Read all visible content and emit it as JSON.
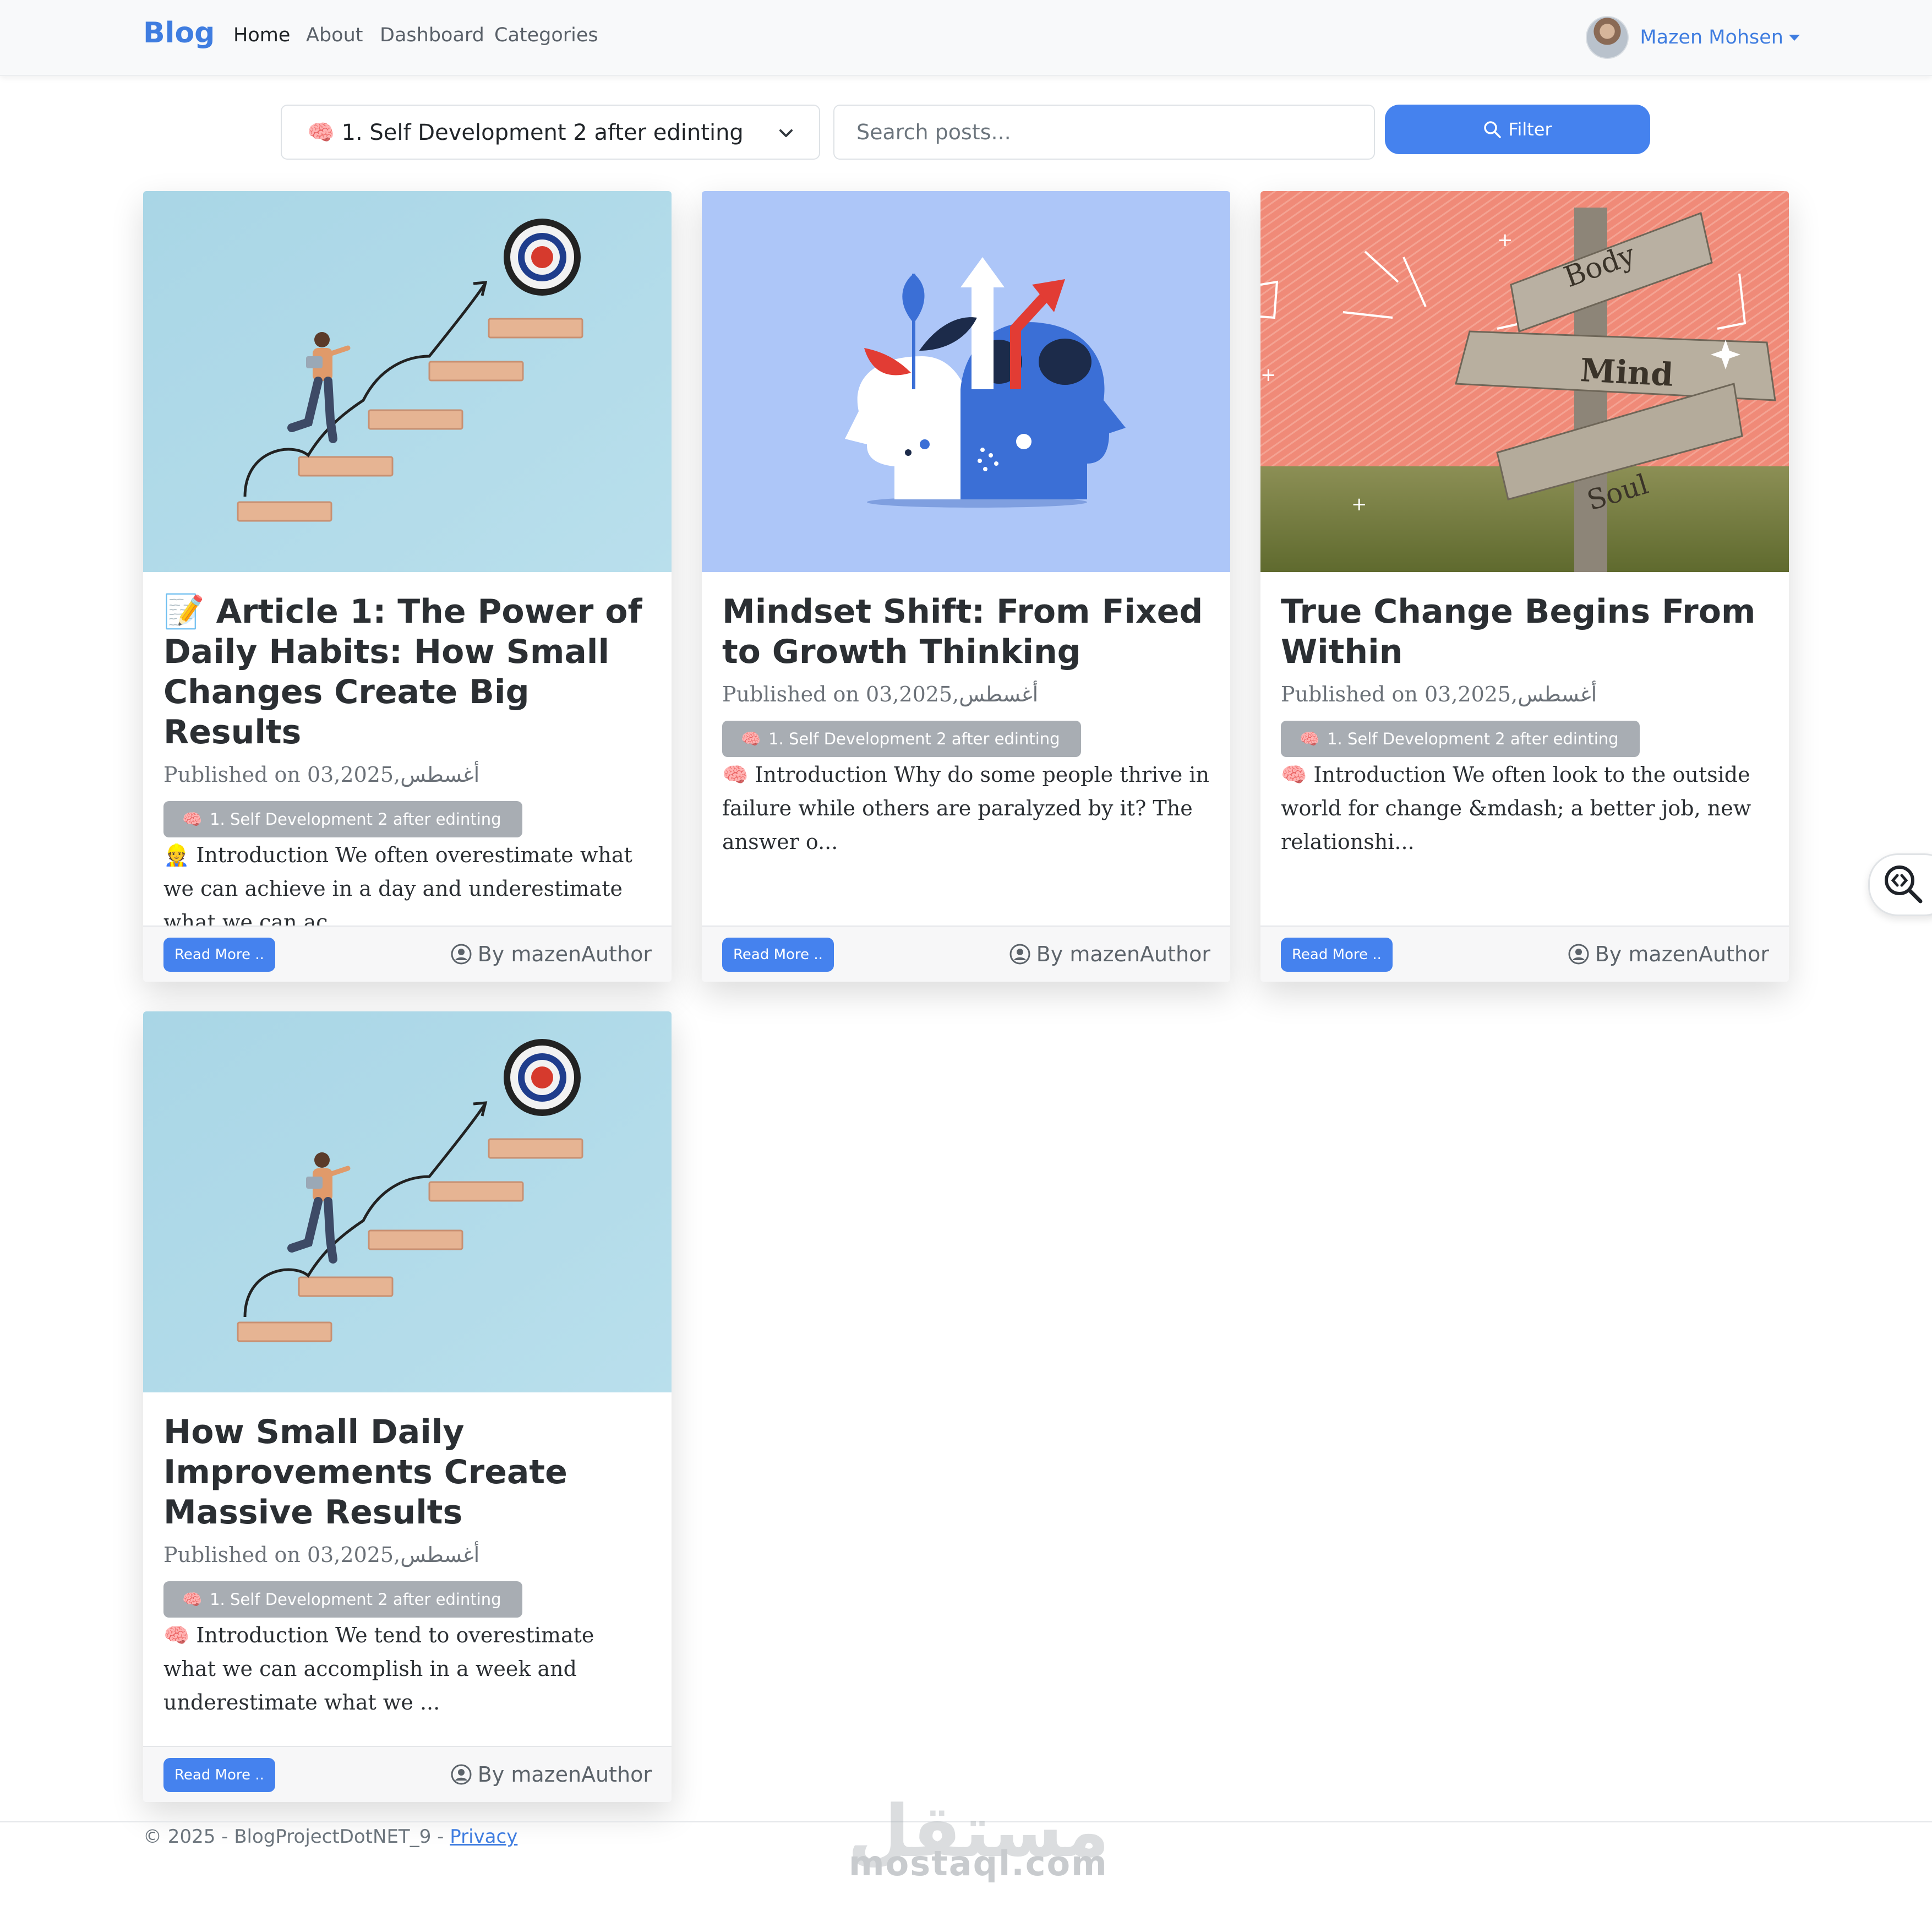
{
  "navbar": {
    "brand": "Blog",
    "links": [
      "Home",
      "About",
      "Dashboard",
      "Categories"
    ],
    "user_name": "Mazen Mohsen"
  },
  "filter": {
    "selected_category": "🧠 1. Self Development 2 after edinting",
    "search_placeholder": "Search posts...",
    "search_value": "",
    "filter_label": "Filter"
  },
  "posts": [
    {
      "title": "📝 Article 1: The Power of Daily Habits: How Small Changes Create Big Results",
      "date": "Published on 03,2025,أغسطس",
      "category": "1. Self Development 2 after edinting",
      "category_emoji": "🧠",
      "excerpt": "👷 Introduction We often overestimate what we can achieve in a day and underestimate what we can ac...",
      "read_more": "Read More ..",
      "author": "By mazenAuthor",
      "image": "stairs-target"
    },
    {
      "title": "Mindset Shift: From Fixed to Growth Thinking",
      "date": "Published on 03,2025,أغسطس",
      "category": "1. Self Development 2 after edinting",
      "category_emoji": "🧠",
      "excerpt": "🧠 Introduction Why do some people thrive in failure while others are paralyzed by it? The answer o...",
      "read_more": "Read More ..",
      "author": "By mazenAuthor",
      "image": "heads-growth"
    },
    {
      "title": "True Change Begins From Within",
      "date": "Published on 03,2025,أغسطس",
      "category": "1. Self Development 2 after edinting",
      "category_emoji": "🧠",
      "excerpt": "🧠 Introduction We often look to the outside world for change &mdash; a better job, new relationshi...",
      "read_more": "Read More ..",
      "author": "By mazenAuthor",
      "image": "signpost",
      "sign_words": [
        "Body",
        "Mind",
        "Soul"
      ]
    },
    {
      "title": "How Small Daily Improvements Create Massive Results",
      "date": "Published on 03,2025,أغسطس",
      "category": "1. Self Development 2 after edinting",
      "category_emoji": "🧠",
      "excerpt": "🧠 Introduction We tend to overestimate what we can accomplish in a week and underestimate what we ...",
      "read_more": "Read More ..",
      "author": "By mazenAuthor",
      "image": "stairs-target"
    }
  ],
  "footer": {
    "copyright": "© 2025 - BlogProjectDotNET_9 -",
    "privacy": "Privacy"
  },
  "watermark": {
    "arabic": "مستقل",
    "latin": "mostaql.com"
  },
  "colors": {
    "brand": "#3f7de0",
    "primary_button": "#4582ee",
    "badge": "#a8adb3"
  }
}
